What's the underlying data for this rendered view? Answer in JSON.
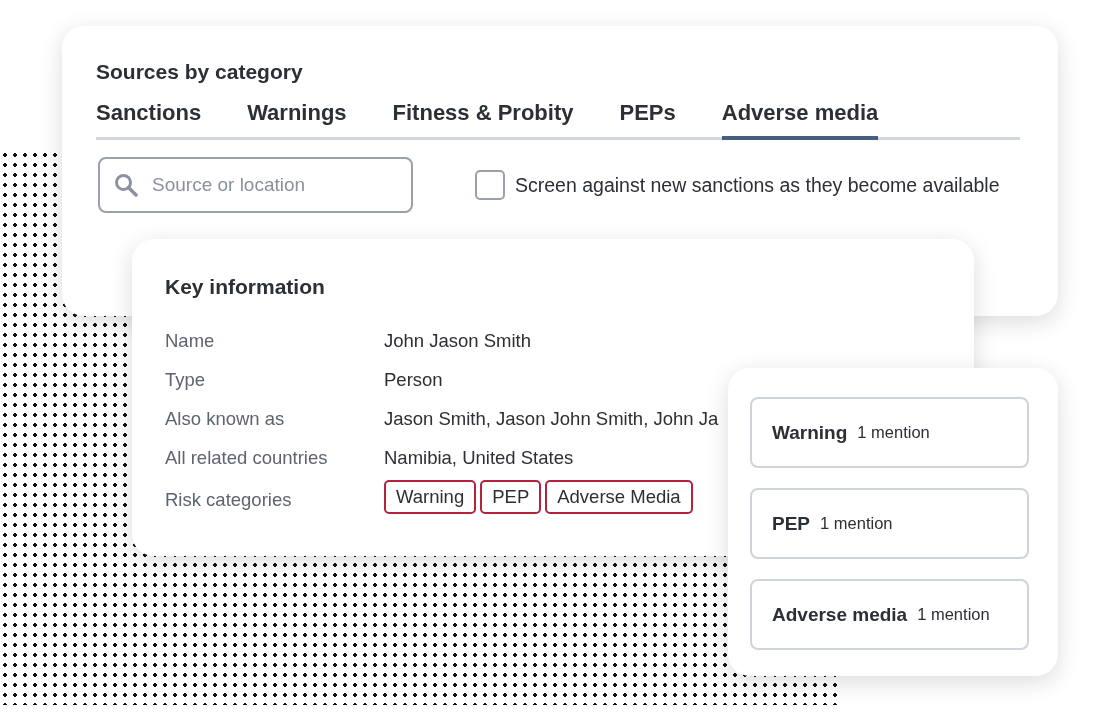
{
  "sources_card": {
    "title": "Sources by category",
    "tabs": [
      {
        "label": "Sanctions",
        "selected": false
      },
      {
        "label": "Warnings",
        "selected": false
      },
      {
        "label": "Fitness & Probity",
        "selected": false
      },
      {
        "label": "PEPs",
        "selected": false
      },
      {
        "label": "Adverse media",
        "selected": true
      }
    ],
    "search": {
      "placeholder": "Source or location"
    },
    "option": {
      "label": "Screen against new sanctions as they become available",
      "checked": false
    }
  },
  "key_information": {
    "title": "Key information",
    "rows": [
      {
        "label": "Name",
        "value": "John Jason Smith"
      },
      {
        "label": "Type",
        "value": "Person"
      },
      {
        "label": "Also known as",
        "value": "Jason Smith, Jason John Smith, John Ja"
      },
      {
        "label": "All related countries",
        "value": "Namibia, United States"
      },
      {
        "label": "Risk categories",
        "tags": [
          "Warning",
          "PEP",
          "Adverse Media"
        ]
      }
    ]
  },
  "mentions": [
    {
      "category": "Warning",
      "count": "1 mention"
    },
    {
      "category": "PEP",
      "count": "1 mention"
    },
    {
      "category": "Adverse media",
      "count": "1 mention"
    }
  ]
}
